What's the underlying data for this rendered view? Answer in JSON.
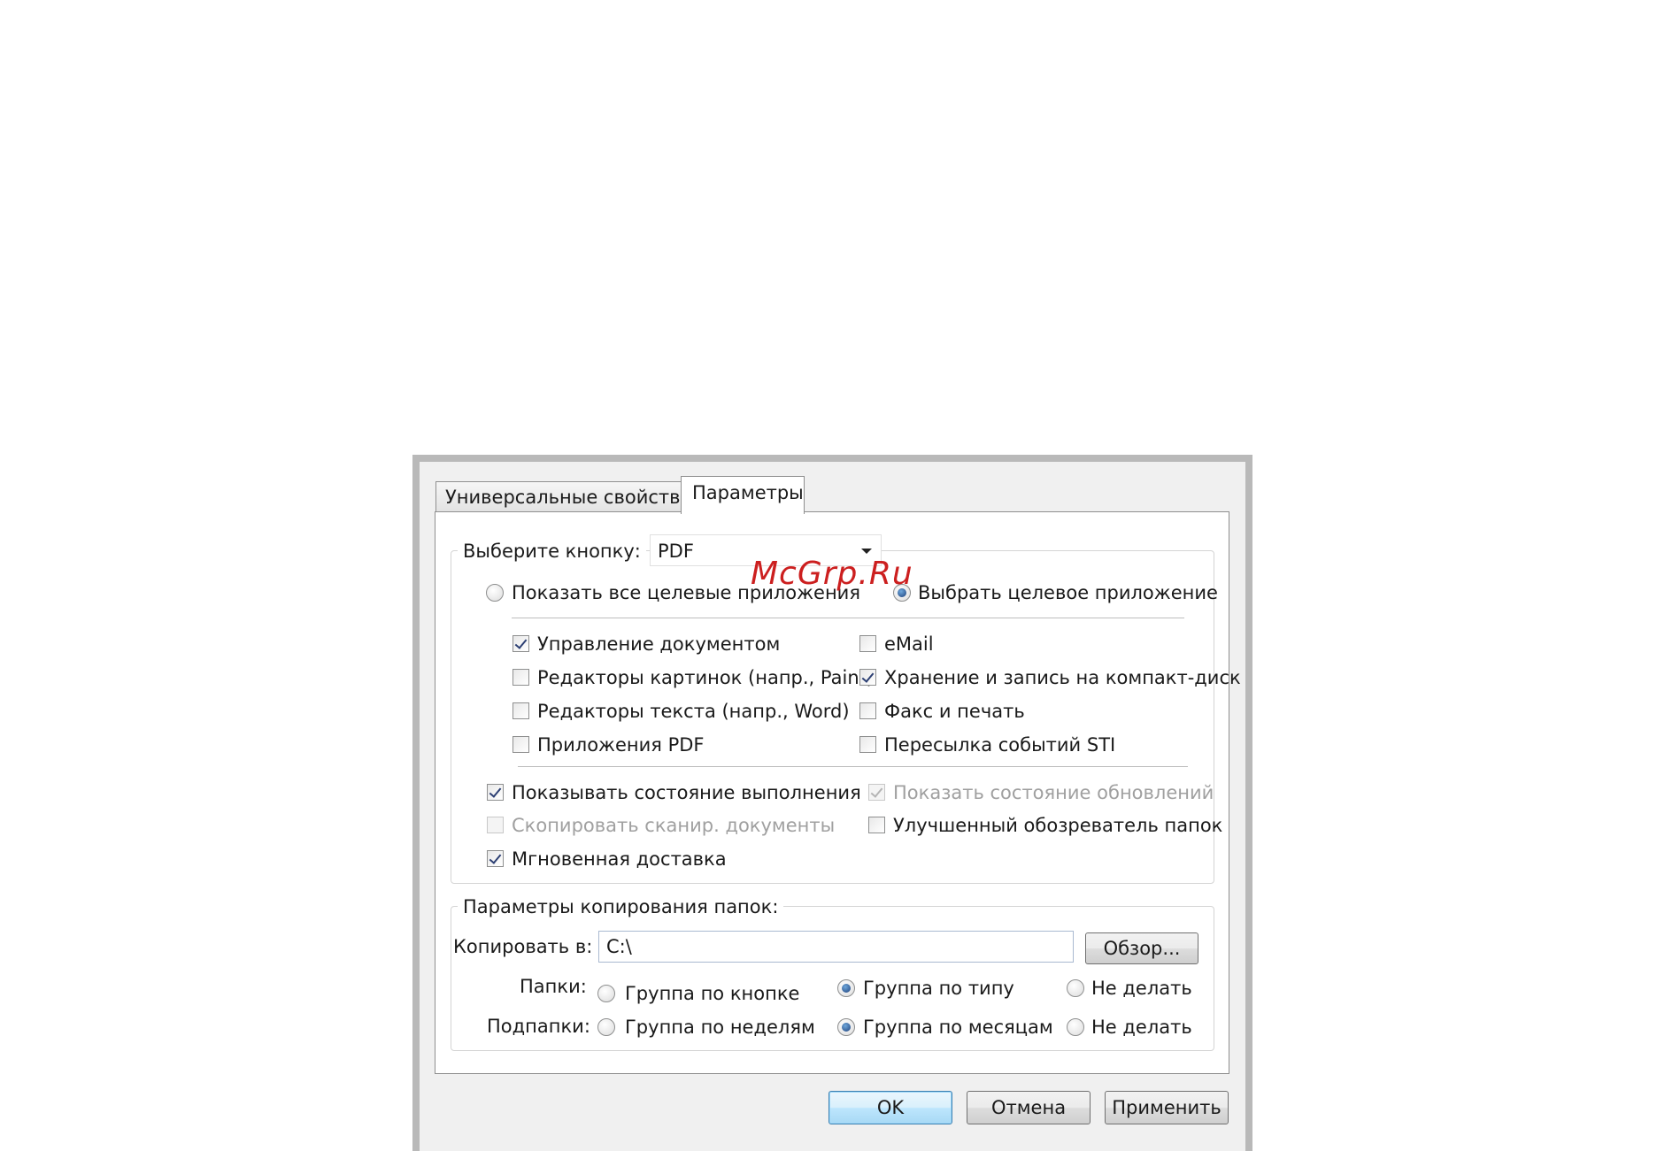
{
  "tabs": [
    {
      "label": "Универсальные свойства",
      "active": false
    },
    {
      "label": "Параметры",
      "active": true
    }
  ],
  "select_button": {
    "label": "Выберите кнопку:",
    "value": "PDF"
  },
  "target_mode": {
    "show_all_label": "Показать все целевые приложения",
    "choose_label": "Выбрать целевое приложение",
    "selected": "choose"
  },
  "apps": [
    {
      "label": "Управление документом",
      "checked": true
    },
    {
      "label": "Редакторы картинок (напр., Paint)",
      "checked": false
    },
    {
      "label": "Редакторы текста (напр., Word)",
      "checked": false
    },
    {
      "label": "Приложения PDF",
      "checked": false
    },
    {
      "label": "eMail",
      "checked": false
    },
    {
      "label": "Хранение и запись на компакт-диск",
      "checked": true
    },
    {
      "label": "Факс и печать",
      "checked": false
    },
    {
      "label": "Пересылка событий STI",
      "checked": false
    }
  ],
  "options": [
    {
      "label": "Показывать состояние выполнения",
      "checked": true,
      "enabled": true
    },
    {
      "label": "Скопировать сканир. документы",
      "checked": false,
      "enabled": false
    },
    {
      "label": "Мгновенная доставка",
      "checked": true,
      "enabled": true
    },
    {
      "label": "Показать состояние обновлений",
      "checked": true,
      "enabled": false
    },
    {
      "label": "Улучшенный обозреватель папок",
      "checked": false,
      "enabled": true
    }
  ],
  "copy_group": {
    "title": "Параметры копирования папок:",
    "copy_to_label": "Копировать в:",
    "copy_to_value": "C:\\",
    "browse_label": "Обзор...",
    "folders_label": "Папки:",
    "subfolders_label": "Подпапки:",
    "folders": {
      "opt1": "Группа по кнопке",
      "opt2": "Группа по типу",
      "opt3": "Не делать",
      "selected": "opt2"
    },
    "subfolders": {
      "opt1": "Группа по неделям",
      "opt2": "Группа по месяцам",
      "opt3": "Не делать",
      "selected": "opt2"
    }
  },
  "buttons": {
    "ok": "OK",
    "cancel": "Отмена",
    "apply": "Применить"
  },
  "watermark": "McGrp.Ru"
}
